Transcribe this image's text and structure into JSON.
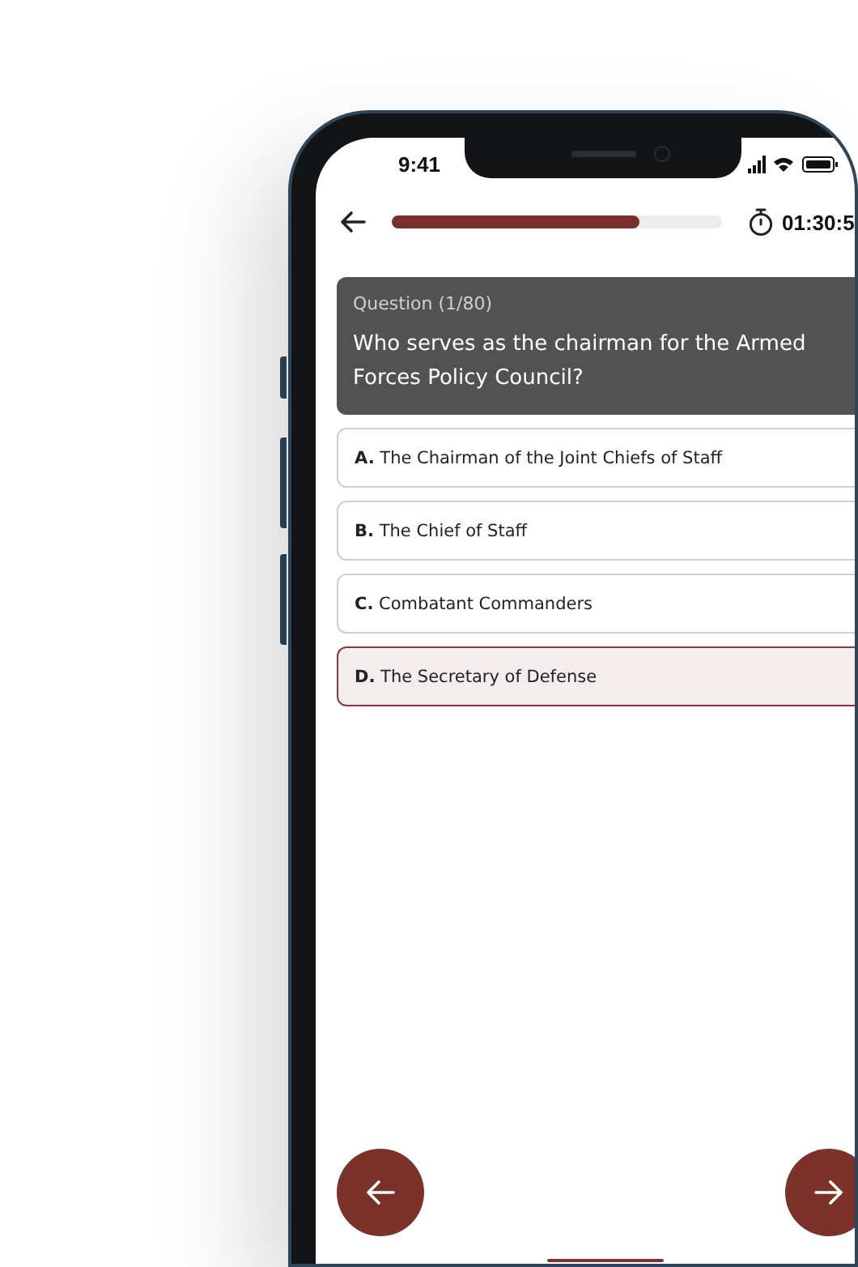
{
  "status_bar": {
    "time": "9:41"
  },
  "header": {
    "progress": {
      "level": 0.75
    },
    "timer": "01:30:5"
  },
  "question": {
    "label": "Question (1/80)",
    "text": "Who serves as the chairman for the Armed Forces Policy Council?"
  },
  "options": [
    {
      "letter": "A.",
      "text": "The Chairman of the Joint Chiefs of Staff",
      "selected": false
    },
    {
      "letter": "B.",
      "text": "The Chief of Staff",
      "selected": false
    },
    {
      "letter": "C.",
      "text": "Combatant Commanders",
      "selected": false
    },
    {
      "letter": "D.",
      "text": "The Secretary of Defense",
      "selected": true
    }
  ]
}
